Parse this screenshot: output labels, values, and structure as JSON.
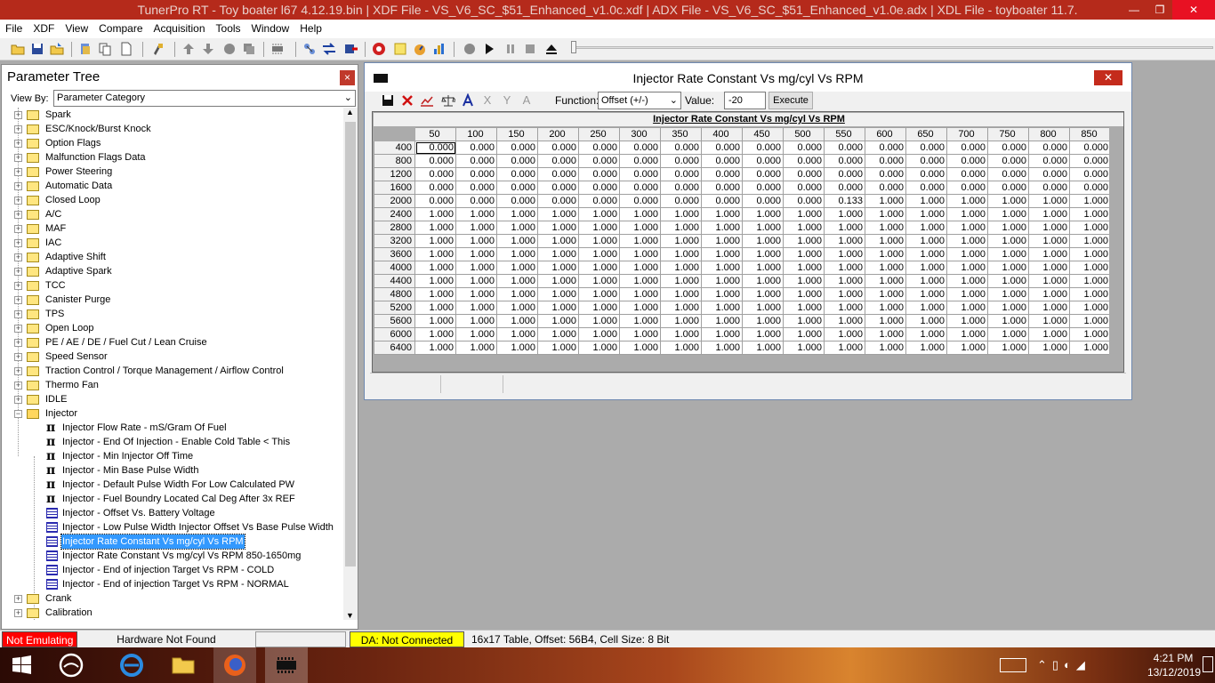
{
  "app": {
    "title": "TunerPro RT - Toy boater l67 4.12.19.bin | XDF File - VS_V6_SC_$51_Enhanced_v1.0c.xdf | ADX File - VS_V6_SC_$51_Enhanced_v1.0e.adx | XDL File - toyboater 11.7.",
    "minimize": "—",
    "restore": "❐",
    "close": "✕"
  },
  "menu": [
    "File",
    "XDF",
    "View",
    "Compare",
    "Acquisition",
    "Tools",
    "Window",
    "Help"
  ],
  "parameter_tree": {
    "title": "Parameter Tree",
    "close": "×",
    "view_by_label": "View By:",
    "view_by_value": "Parameter Category",
    "categories_top": [
      "Spark",
      "ESC/Knock/Burst Knock",
      "Option Flags",
      "Malfunction Flags Data",
      "Power Steering",
      "Automatic Data",
      "Closed Loop",
      "A/C",
      "MAF",
      "IAC",
      "Adaptive Shift",
      "Adaptive Spark",
      "TCC",
      "Canister Purge",
      "TPS",
      "Open Loop",
      "PE / AE / DE / Fuel Cut / Lean Cruise",
      "Speed Sensor",
      "Traction Control / Torque Management / Airflow Control",
      "Thermo Fan",
      "IDLE"
    ],
    "open_category": "Injector",
    "injector_items": [
      {
        "label": "Injector Flow Rate - mS/Gram Of Fuel",
        "icon": "pi"
      },
      {
        "label": "Injector - End Of Injection - Enable Cold Table < This",
        "icon": "pi"
      },
      {
        "label": "Injector - Min Injector Off Time",
        "icon": "pi"
      },
      {
        "label": "Injector - Min Base Pulse Width",
        "icon": "pi"
      },
      {
        "label": "Injector - Default Pulse Width For Low Calculated PW",
        "icon": "pi"
      },
      {
        "label": "Injector - Fuel Boundry Located Cal Deg After 3x REF",
        "icon": "pi"
      },
      {
        "label": "Injector - Offset Vs. Battery Voltage",
        "icon": "grid"
      },
      {
        "label": "Injector - Low Pulse Width Injector Offset Vs Base Pulse Width",
        "icon": "grid"
      },
      {
        "label": "Injector Rate Constant Vs mg/cyl Vs RPM",
        "icon": "grid",
        "selected": true
      },
      {
        "label": "Injector Rate Constant Vs mg/cyl Vs RPM 850-1650mg",
        "icon": "grid"
      },
      {
        "label": "Injector - End of injection Target Vs RPM - COLD",
        "icon": "grid"
      },
      {
        "label": "Injector - End of injection Target Vs RPM - NORMAL",
        "icon": "grid"
      }
    ],
    "categories_bottom": [
      "Crank",
      "Calibration"
    ],
    "pi_glyph": "π"
  },
  "table_window": {
    "title": "Injector Rate Constant Vs mg/cyl Vs RPM",
    "close": "✕",
    "function_label": "Function:",
    "function_value": "Offset (+/-)",
    "value_label": "Value:",
    "value": "-20",
    "execute": "Execute",
    "caption": "Injector Rate Constant Vs mg/cyl Vs RPM",
    "columns": [
      "50",
      "100",
      "150",
      "200",
      "250",
      "300",
      "350",
      "400",
      "450",
      "500",
      "550",
      "600",
      "650",
      "700",
      "750",
      "800",
      "850"
    ],
    "rows": [
      {
        "rpm": "400",
        "values": [
          "0.000",
          "0.000",
          "0.000",
          "0.000",
          "0.000",
          "0.000",
          "0.000",
          "0.000",
          "0.000",
          "0.000",
          "0.000",
          "0.000",
          "0.000",
          "0.000",
          "0.000",
          "0.000",
          "0.000"
        ]
      },
      {
        "rpm": "800",
        "values": [
          "0.000",
          "0.000",
          "0.000",
          "0.000",
          "0.000",
          "0.000",
          "0.000",
          "0.000",
          "0.000",
          "0.000",
          "0.000",
          "0.000",
          "0.000",
          "0.000",
          "0.000",
          "0.000",
          "0.000"
        ]
      },
      {
        "rpm": "1200",
        "values": [
          "0.000",
          "0.000",
          "0.000",
          "0.000",
          "0.000",
          "0.000",
          "0.000",
          "0.000",
          "0.000",
          "0.000",
          "0.000",
          "0.000",
          "0.000",
          "0.000",
          "0.000",
          "0.000",
          "0.000"
        ]
      },
      {
        "rpm": "1600",
        "values": [
          "0.000",
          "0.000",
          "0.000",
          "0.000",
          "0.000",
          "0.000",
          "0.000",
          "0.000",
          "0.000",
          "0.000",
          "0.000",
          "0.000",
          "0.000",
          "0.000",
          "0.000",
          "0.000",
          "0.000"
        ]
      },
      {
        "rpm": "2000",
        "values": [
          "0.000",
          "0.000",
          "0.000",
          "0.000",
          "0.000",
          "0.000",
          "0.000",
          "0.000",
          "0.000",
          "0.000",
          "0.133",
          "1.000",
          "1.000",
          "1.000",
          "1.000",
          "1.000",
          "1.000"
        ]
      },
      {
        "rpm": "2400",
        "values": [
          "1.000",
          "1.000",
          "1.000",
          "1.000",
          "1.000",
          "1.000",
          "1.000",
          "1.000",
          "1.000",
          "1.000",
          "1.000",
          "1.000",
          "1.000",
          "1.000",
          "1.000",
          "1.000",
          "1.000"
        ]
      },
      {
        "rpm": "2800",
        "values": [
          "1.000",
          "1.000",
          "1.000",
          "1.000",
          "1.000",
          "1.000",
          "1.000",
          "1.000",
          "1.000",
          "1.000",
          "1.000",
          "1.000",
          "1.000",
          "1.000",
          "1.000",
          "1.000",
          "1.000"
        ]
      },
      {
        "rpm": "3200",
        "values": [
          "1.000",
          "1.000",
          "1.000",
          "1.000",
          "1.000",
          "1.000",
          "1.000",
          "1.000",
          "1.000",
          "1.000",
          "1.000",
          "1.000",
          "1.000",
          "1.000",
          "1.000",
          "1.000",
          "1.000"
        ]
      },
      {
        "rpm": "3600",
        "values": [
          "1.000",
          "1.000",
          "1.000",
          "1.000",
          "1.000",
          "1.000",
          "1.000",
          "1.000",
          "1.000",
          "1.000",
          "1.000",
          "1.000",
          "1.000",
          "1.000",
          "1.000",
          "1.000",
          "1.000"
        ]
      },
      {
        "rpm": "4000",
        "values": [
          "1.000",
          "1.000",
          "1.000",
          "1.000",
          "1.000",
          "1.000",
          "1.000",
          "1.000",
          "1.000",
          "1.000",
          "1.000",
          "1.000",
          "1.000",
          "1.000",
          "1.000",
          "1.000",
          "1.000"
        ]
      },
      {
        "rpm": "4400",
        "values": [
          "1.000",
          "1.000",
          "1.000",
          "1.000",
          "1.000",
          "1.000",
          "1.000",
          "1.000",
          "1.000",
          "1.000",
          "1.000",
          "1.000",
          "1.000",
          "1.000",
          "1.000",
          "1.000",
          "1.000"
        ]
      },
      {
        "rpm": "4800",
        "values": [
          "1.000",
          "1.000",
          "1.000",
          "1.000",
          "1.000",
          "1.000",
          "1.000",
          "1.000",
          "1.000",
          "1.000",
          "1.000",
          "1.000",
          "1.000",
          "1.000",
          "1.000",
          "1.000",
          "1.000"
        ]
      },
      {
        "rpm": "5200",
        "values": [
          "1.000",
          "1.000",
          "1.000",
          "1.000",
          "1.000",
          "1.000",
          "1.000",
          "1.000",
          "1.000",
          "1.000",
          "1.000",
          "1.000",
          "1.000",
          "1.000",
          "1.000",
          "1.000",
          "1.000"
        ]
      },
      {
        "rpm": "5600",
        "values": [
          "1.000",
          "1.000",
          "1.000",
          "1.000",
          "1.000",
          "1.000",
          "1.000",
          "1.000",
          "1.000",
          "1.000",
          "1.000",
          "1.000",
          "1.000",
          "1.000",
          "1.000",
          "1.000",
          "1.000"
        ]
      },
      {
        "rpm": "6000",
        "values": [
          "1.000",
          "1.000",
          "1.000",
          "1.000",
          "1.000",
          "1.000",
          "1.000",
          "1.000",
          "1.000",
          "1.000",
          "1.000",
          "1.000",
          "1.000",
          "1.000",
          "1.000",
          "1.000",
          "1.000"
        ]
      },
      {
        "rpm": "6400",
        "values": [
          "1.000",
          "1.000",
          "1.000",
          "1.000",
          "1.000",
          "1.000",
          "1.000",
          "1.000",
          "1.000",
          "1.000",
          "1.000",
          "1.000",
          "1.000",
          "1.000",
          "1.000",
          "1.000",
          "1.000"
        ]
      }
    ]
  },
  "status": {
    "emulating": "Not Emulating",
    "hardware": "Hardware Not Found",
    "da": "DA: Not Connected",
    "info": "16x17 Table, Offset: 56B4,  Cell Size: 8 Bit"
  },
  "taskbar": {
    "time": "4:21 PM",
    "date": "13/12/2019"
  },
  "colors": {
    "title_bar": "#b52a1b",
    "selection": "#3399ff",
    "not_emulating": "#ff0000",
    "da_status": "#ffff00"
  }
}
